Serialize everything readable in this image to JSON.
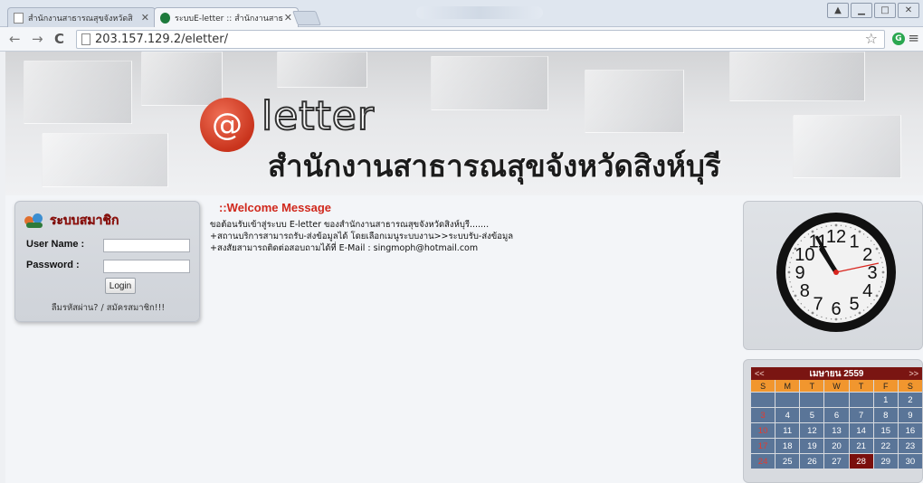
{
  "browser": {
    "tabs": [
      {
        "title": "สำนักงานสาธารณสุขจังหวัดสิ",
        "active": false
      },
      {
        "title": "ระบบE-letter :: สำนักงานสาธ",
        "active": true
      }
    ],
    "url": "203.157.129.2/eletter/",
    "extension_icon_label": "G",
    "icons": [
      "back-icon",
      "forward-icon",
      "reload-icon",
      "page-icon",
      "star-icon",
      "extension-icon",
      "menu-icon",
      "minimize-icon",
      "maximize-icon",
      "close-icon"
    ]
  },
  "banner": {
    "logo_symbol": "@",
    "logo_word": "letter",
    "org_name": "สำนักงานสาธารณสุขจังหวัดสิงห์บุรี"
  },
  "member": {
    "title": "ระบบสมาชิก",
    "username_label": "User Name :",
    "password_label": "Password :",
    "username_value": "",
    "password_value": "",
    "login_label": "Login",
    "links": "ลืมรหัสผ่าน? / สมัครสมาชิก!!!"
  },
  "welcome": {
    "title": "::Welcome Message",
    "lines": [
      "ขอต้อนรับเข้าสู่ระบบ E-letter ของสำนักงานสาธารณสุขจังหวัดสิงห์บุรี.......",
      " +สถานบริการสามารถรับ-ส่งข้อมูลได้ โดยเลือกเมนูระบบงาน>>ระบบรับ-ส่งข้อมูล",
      " +สงสัยสามารถติดต่อสอบถามได้ที่ E-Mail : singmoph@hotmail.com"
    ]
  },
  "clock": {
    "numerals": [
      "12",
      "1",
      "2",
      "3",
      "4",
      "5",
      "6",
      "7",
      "8",
      "9",
      "10",
      "11"
    ],
    "time": {
      "hour": 10,
      "minute": 55,
      "second": 13
    }
  },
  "calendar": {
    "month_label": "เมษายน 2559",
    "prev": "<<",
    "next": ">>",
    "weekdays": [
      "S",
      "M",
      "T",
      "W",
      "T",
      "F",
      "S"
    ],
    "weeks": [
      [
        "",
        "",
        "",
        "",
        "",
        "1",
        "2"
      ],
      [
        "3",
        "4",
        "5",
        "6",
        "7",
        "8",
        "9"
      ],
      [
        "10",
        "11",
        "12",
        "13",
        "14",
        "15",
        "16"
      ],
      [
        "17",
        "18",
        "19",
        "20",
        "21",
        "22",
        "23"
      ],
      [
        "24",
        "25",
        "26",
        "27",
        "28",
        "29",
        "30"
      ]
    ],
    "today": "28"
  },
  "colors": {
    "accent_red": "#d0281c",
    "calendar_header": "#7a1512",
    "calendar_dow": "#f1962e",
    "calendar_day": "#5a7598"
  }
}
